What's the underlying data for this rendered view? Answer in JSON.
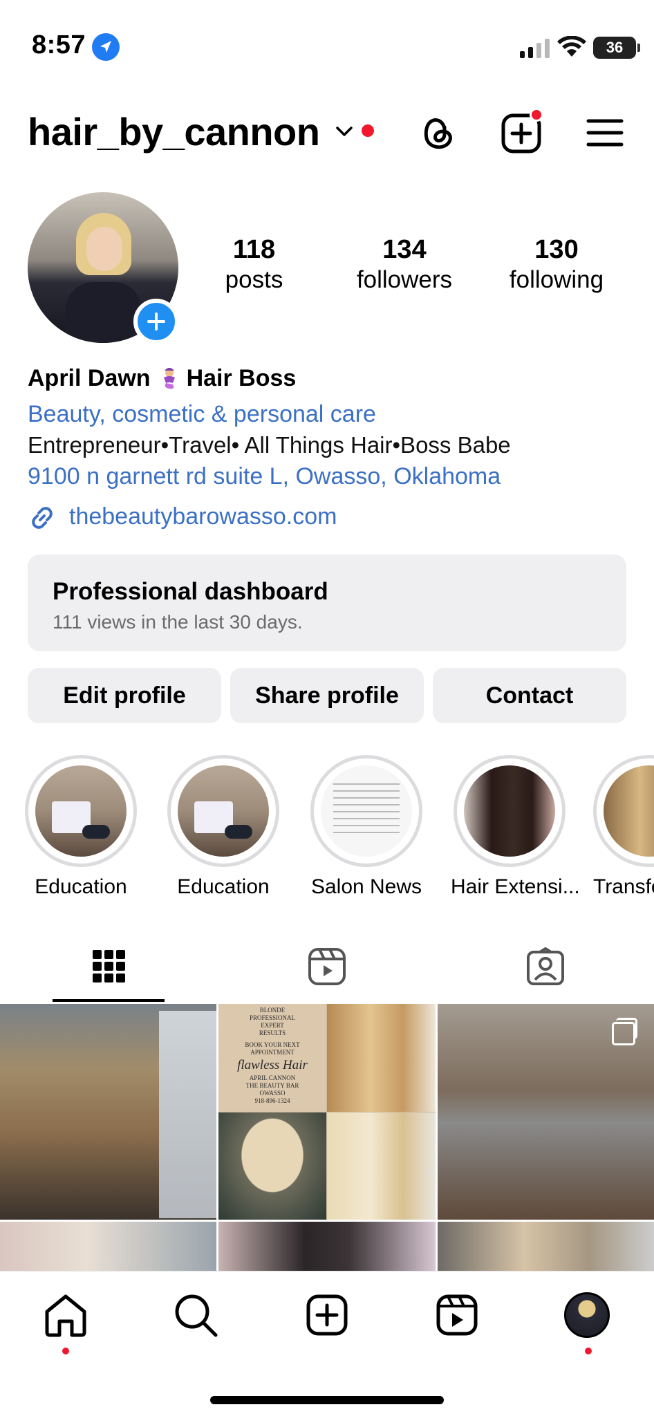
{
  "status_bar": {
    "time": "8:57",
    "battery": "36"
  },
  "header": {
    "username": "hair_by_cannon"
  },
  "profile": {
    "stats": {
      "posts": {
        "count": "118",
        "label": "posts"
      },
      "followers": {
        "count": "134",
        "label": "followers"
      },
      "following": {
        "count": "130",
        "label": "following"
      }
    },
    "name_part1": "April Dawn",
    "name_part2": "Hair Boss",
    "category": "Beauty, cosmetic & personal care",
    "bio": "Entrepreneur•Travel• All Things Hair•Boss Babe",
    "address": "9100 n garnett rd suite L, Owasso, Oklahoma",
    "website": "thebeautybarowasso.com"
  },
  "dashboard": {
    "title": "Professional dashboard",
    "subtitle": "111 views in the last 30 days."
  },
  "actions": {
    "edit": "Edit profile",
    "share": "Share profile",
    "contact": "Contact"
  },
  "highlights": [
    {
      "label": "Education"
    },
    {
      "label": "Education"
    },
    {
      "label": "Salon News"
    },
    {
      "label": "Hair Extensi..."
    },
    {
      "label": "Transfo"
    }
  ],
  "posts": {
    "p2_card": {
      "line1": "BLONDE",
      "line2": "PROFESSIONAL",
      "line3": "EXPERT",
      "line4": "RESULTS",
      "line5": "BOOK YOUR NEXT",
      "line6": "APPOINTMENT",
      "headline": "flawless Hair",
      "line7": "APRIL CANNON",
      "line8": "THE BEAUTY BAR",
      "line9": "OWASSO",
      "phone": "918-896-1324"
    }
  },
  "colors": {
    "link_blue": "#3b70c4",
    "notification_red": "#f0182f",
    "button_gray": "#efeff1",
    "accent_blue": "#1f8ff1"
  },
  "icons": {
    "header": [
      "threads-icon",
      "new-post-icon",
      "menu-icon"
    ],
    "tabs": [
      "grid-icon",
      "reels-icon",
      "tagged-icon"
    ],
    "nav": [
      "home-icon",
      "search-icon",
      "create-icon",
      "reels-icon",
      "profile-avatar"
    ]
  }
}
